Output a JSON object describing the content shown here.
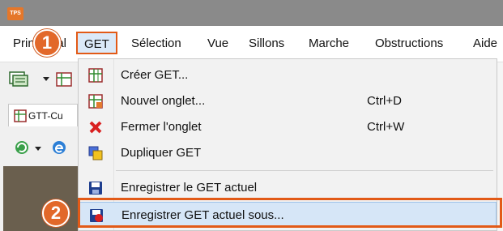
{
  "app": {
    "logo_text": "TPS"
  },
  "menubar": {
    "items": [
      {
        "label": "Prin"
      },
      {
        "label": "pal"
      },
      {
        "label": "GET"
      },
      {
        "label": "Sélection"
      },
      {
        "label": "Vue"
      },
      {
        "label": "Sillons"
      },
      {
        "label": "Marche"
      },
      {
        "label": "Obstructions"
      },
      {
        "label": "Aide"
      }
    ]
  },
  "tab": {
    "label": "GTT-Cu"
  },
  "dropdown": {
    "items": [
      {
        "label": "Créer GET...",
        "shortcut": "",
        "icon": "grid-icon"
      },
      {
        "label": "Nouvel onglet...",
        "shortcut": "Ctrl+D",
        "icon": "grid-tab-icon"
      },
      {
        "label": "Fermer l'onglet",
        "shortcut": "Ctrl+W",
        "icon": "close-red-icon"
      },
      {
        "label": "Dupliquer GET",
        "shortcut": "",
        "icon": "duplicate-icon"
      },
      {
        "label": "Enregistrer le GET actuel",
        "shortcut": "",
        "icon": "save-icon"
      },
      {
        "label": "Enregistrer GET actuel sous...",
        "shortcut": "",
        "icon": "save-as-icon"
      }
    ]
  },
  "badges": {
    "step1": "1",
    "step2": "2"
  },
  "colors": {
    "accent": "#e25a17",
    "highlight": "#d6e6f7",
    "titlebar": "#8a8a8a"
  }
}
